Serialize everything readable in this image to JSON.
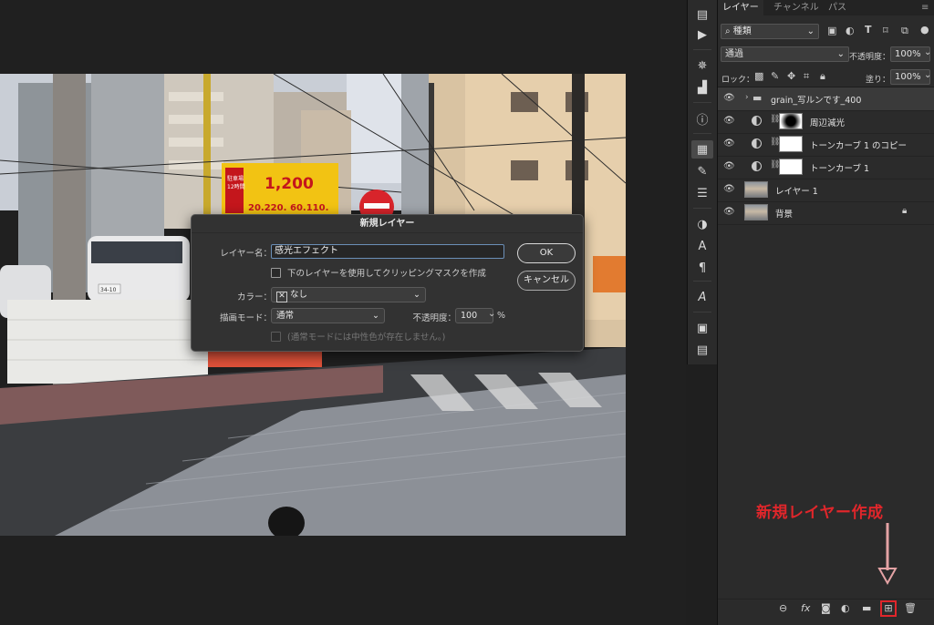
{
  "panel": {
    "tabs": [
      "レイヤー",
      "チャンネル",
      "パス"
    ],
    "filter_value": "種類",
    "blend_mode": "通過",
    "opacity_label": "不透明度：",
    "opacity_value": "100%",
    "lock_label": "ロック：",
    "fill_label": "塗り：",
    "fill_value": "100%",
    "layers": [
      {
        "name": "grain_写ルンです_400",
        "kind": "group"
      },
      {
        "name": "周辺減光",
        "kind": "adjustment"
      },
      {
        "name": "トーンカーブ 1 のコピー",
        "kind": "adjustment"
      },
      {
        "name": "トーンカーブ 1",
        "kind": "adjustment"
      },
      {
        "name": "レイヤー 1",
        "kind": "pixel"
      },
      {
        "name": "背景",
        "kind": "background"
      }
    ]
  },
  "dialog": {
    "title": "新規レイヤー",
    "name_label": "レイヤー名：",
    "name_value": "感光エフェクト",
    "clip_label": "下のレイヤーを使用してクリッピングマスクを作成",
    "color_label": "カラー：",
    "color_value": "なし",
    "mode_label": "描画モード：",
    "mode_value": "通常",
    "opacity_label": "不透明度：",
    "opacity_value": "100",
    "opacity_unit": "%",
    "neutral_note": "(通常モードには中性色が存在しません。)",
    "ok_label": "OK",
    "cancel_label": "キャンセル"
  },
  "photo": {
    "sign_price": "1,200",
    "sign_line1": "駐車場",
    "sign_line2": "12時間",
    "sign_prices_small": [
      "20.220.",
      "60.110."
    ],
    "plate": "34-10"
  },
  "annotation": {
    "text": "新規レイヤー作成",
    "color": "#e0262b"
  },
  "colors": {
    "panel_bg": "#2b2b2b",
    "dialog_bg": "#323232",
    "accent_red": "#e0262b"
  }
}
